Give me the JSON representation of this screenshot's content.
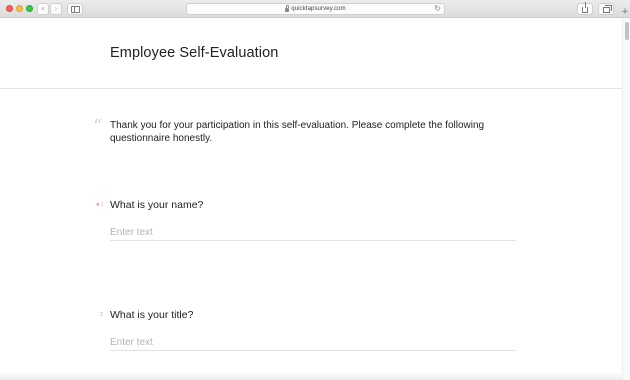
{
  "browser": {
    "url": "quicktapsurvey.com",
    "back_icon": "‹",
    "forward_icon": "›",
    "reload_icon": "↻",
    "new_tab_icon": "+"
  },
  "survey": {
    "title": "Employee Self-Evaluation",
    "intro_quote_icon": "“",
    "intro": "Thank you for your participation in this self-evaluation. Please complete the following questionnaire honestly.",
    "questions": [
      {
        "number": "1",
        "required_marker": "●",
        "label": "What is your name?",
        "placeholder": "Enter text"
      },
      {
        "number": "2",
        "label": "What is your title?",
        "placeholder": "Enter text"
      }
    ]
  },
  "colors": {
    "required": "#f0908a",
    "placeholder": "#b4b4b4",
    "traffic_red": "#fc605b",
    "traffic_yellow": "#fdbc40",
    "traffic_green": "#34c84a"
  }
}
